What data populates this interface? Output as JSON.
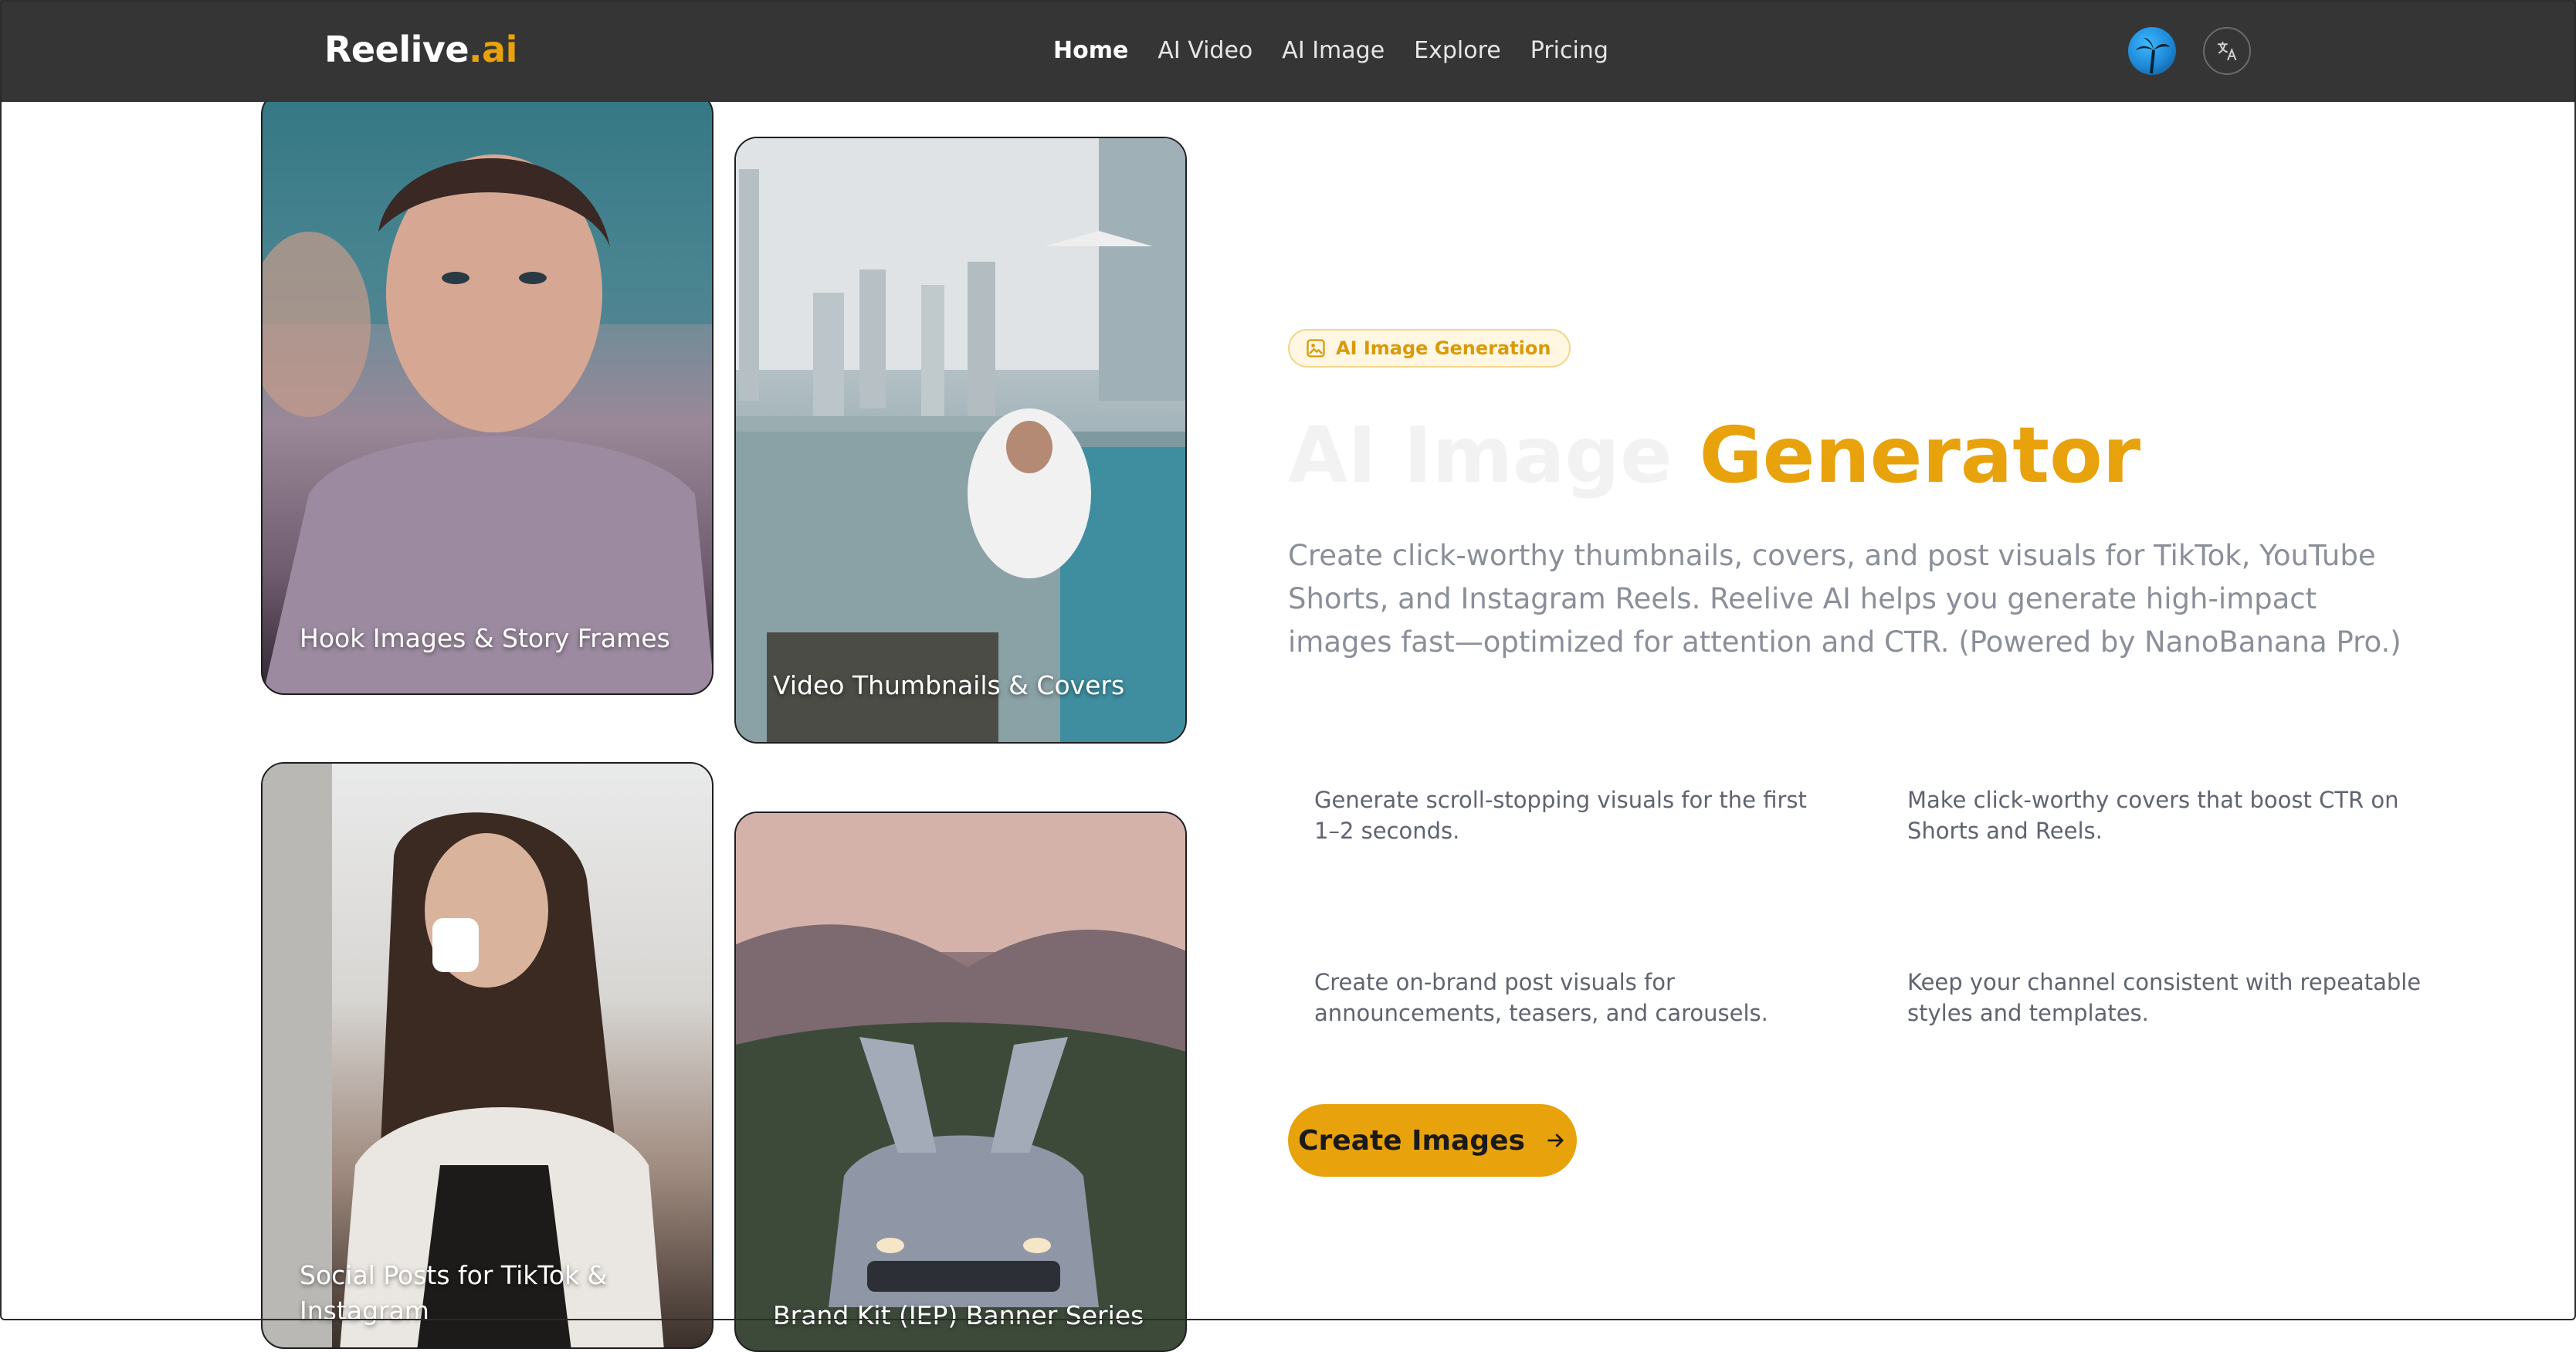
{
  "header": {
    "logo_main": "Reelive",
    "logo_suffix": ".ai",
    "nav": [
      "Home",
      "AI Video",
      "AI Image",
      "Explore",
      "Pricing"
    ],
    "active_nav": "Home"
  },
  "cards": [
    {
      "caption": "Hook Images & Story Frames"
    },
    {
      "caption": "Video Thumbnails & Covers"
    },
    {
      "caption": "Social Posts for TikTok & Instagram"
    },
    {
      "caption": "Brand Kit (IEP) Banner Series"
    }
  ],
  "hero": {
    "badge": "AI Image Generation",
    "title_pale": "AI Image",
    "title_accent": "Generator",
    "description": "Create click-worthy thumbnails, covers, and post visuals for TikTok, YouTube Shorts, and Instagram Reels. Reelive AI helps you generate high-impact images fast—optimized for attention and CTR. (Powered by NanoBanana Pro.)"
  },
  "features": [
    "Generate scroll-stopping visuals for the first 1–2 seconds.",
    "Make click-worthy covers that boost CTR on Shorts and Reels.",
    "Create on-brand post visuals for announcements, teasers, and carousels.",
    "Keep your channel consistent with repeatable styles and templates."
  ],
  "cta": {
    "label": "Create Images"
  },
  "colors": {
    "accent": "#e8a20c",
    "header_bg": "#353535",
    "badge_bg": "#fff7e2"
  }
}
